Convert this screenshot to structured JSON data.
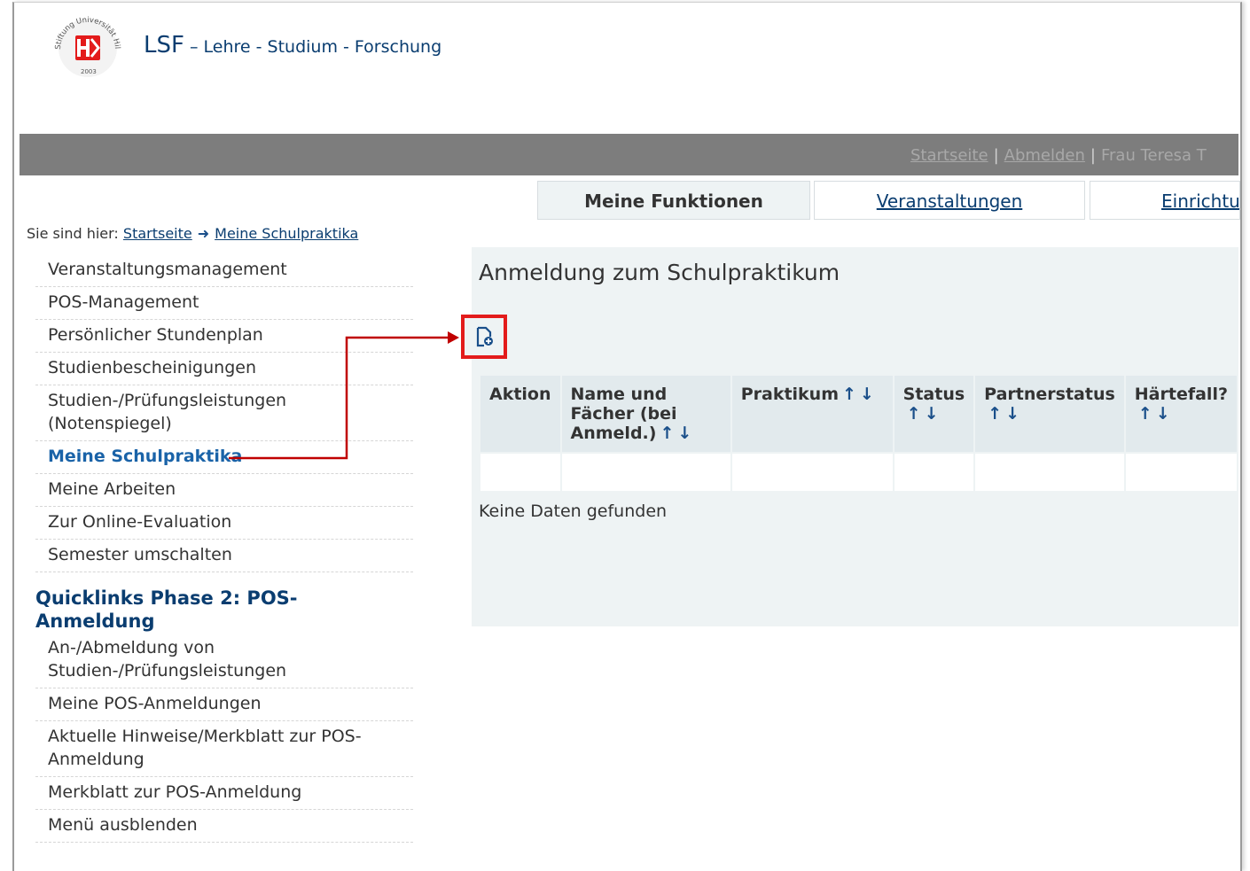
{
  "header": {
    "logo_text": "Stiftung Universität Hildesheim 2003",
    "title_main": "LSF",
    "title_sub": " – Lehre - Studium - Forschung"
  },
  "topbar": {
    "links": [
      "Startseite",
      "Abmelden"
    ],
    "user": "Frau Teresa T"
  },
  "tabs": [
    {
      "label": "Meine Funktionen",
      "active": true
    },
    {
      "label": "Veranstaltungen",
      "active": false
    },
    {
      "label": "Einrichtu",
      "active": false
    }
  ],
  "breadcrumb": {
    "prefix": "Sie sind hier:",
    "items": [
      "Startseite",
      "Meine Schulpraktika"
    ]
  },
  "sidebar": {
    "items": [
      "Veranstaltungsmanagement",
      "POS-Management",
      "Persönlicher Stundenplan",
      "Studienbescheinigungen",
      "Studien-/Prüfungsleistungen (Notenspiegel)",
      "Meine Schulpraktika",
      "Meine Arbeiten",
      "Zur Online-Evaluation",
      "Semester umschalten"
    ],
    "active_index": 5,
    "quicklinks_heading": "Quicklinks Phase 2: POS-Anmeldung",
    "quicklinks": [
      "An-/Abmeldung von Studien-/Prüfungsleistungen",
      "Meine POS-Anmeldungen",
      "Aktuelle Hinweise/Merkblatt zur POS-Anmeldung",
      "Merkblatt zur POS-Anmeldung",
      "Menü ausblenden"
    ]
  },
  "main": {
    "title": "Anmeldung zum Schulpraktikum",
    "add_icon": "add-document-icon",
    "table": {
      "headers": [
        {
          "label": "Aktion",
          "sortable": false
        },
        {
          "label": "Name und Fächer (bei Anmeld.)",
          "sortable": true
        },
        {
          "label": "Praktikum",
          "sortable": true
        },
        {
          "label": "Status",
          "sortable": true
        },
        {
          "label": "Partnerstatus",
          "sortable": true
        },
        {
          "label": "Härtefall?",
          "sortable": true
        }
      ],
      "sort_glyphs": "↑↓"
    },
    "empty_text": "Keine Daten gefunden"
  },
  "colors": {
    "brand_blue": "#0a3d70",
    "link_active": "#1a63a8",
    "topbar_gray": "#7d7d7d",
    "content_bg": "#eef3f4",
    "callout_red": "#c00000"
  }
}
